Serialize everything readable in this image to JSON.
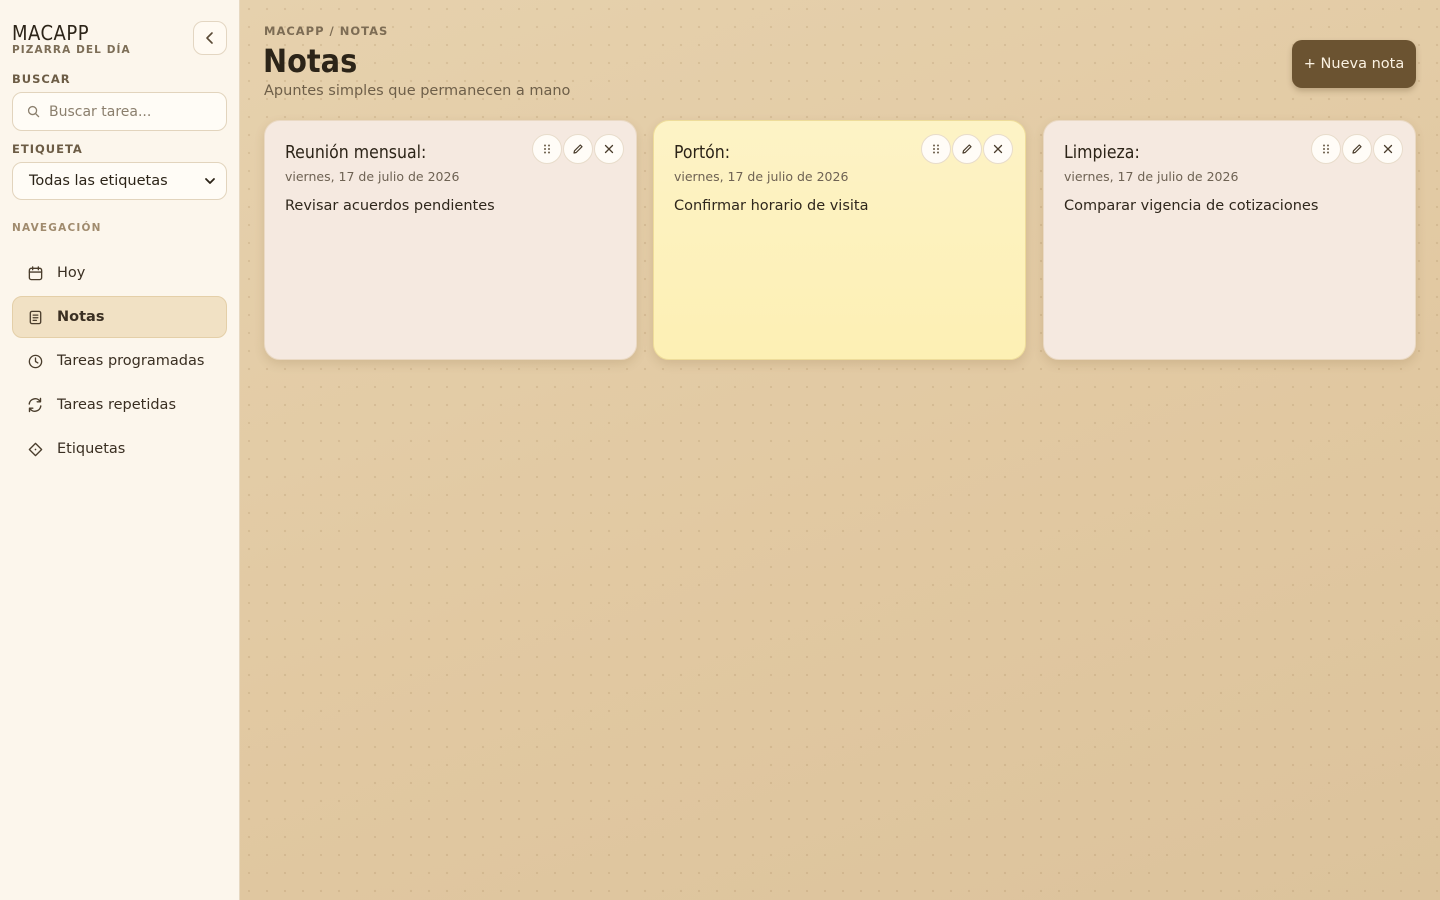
{
  "brand": {
    "title": "MACAPP",
    "subtitle": "PIZARRA DEL DÍA"
  },
  "sidebar": {
    "search_label": "BUSCAR",
    "search_placeholder": "Buscar tarea...",
    "tag_label": "ETIQUETA",
    "tag_selected": "Todas las etiquetas",
    "nav_label": "NAVEGACIÓN",
    "items": [
      {
        "label": "Hoy",
        "icon": "calendar-icon",
        "active": false
      },
      {
        "label": "Notas",
        "icon": "note-icon",
        "active": true
      },
      {
        "label": "Tareas programadas",
        "icon": "clock-icon",
        "active": false
      },
      {
        "label": "Tareas repetidas",
        "icon": "repeat-icon",
        "active": false
      },
      {
        "label": "Etiquetas",
        "icon": "tag-icon",
        "active": false
      }
    ]
  },
  "header": {
    "breadcrumb": "MACAPP / NOTAS",
    "title": "Notas",
    "subtitle": "Apuntes simples que permanecen a mano",
    "new_button": "+ Nueva nota"
  },
  "notes": [
    {
      "title": "Reunión mensual:",
      "date": "viernes, 17 de julio de 2026",
      "body": "Revisar acuerdos pendientes",
      "color": "#f5e9e0"
    },
    {
      "title": "Portón:",
      "date": "viernes, 17 de julio de 2026",
      "body": "Confirmar horario de visita",
      "color": "#fdf1bd"
    },
    {
      "title": "Limpieza:",
      "date": "viernes, 17 de julio de 2026",
      "body": "Comparar vigencia de cotizaciones",
      "color": "#f5e9e0"
    }
  ],
  "colors": {
    "accent": "#6b5331",
    "sidebar_bg": "#fcf6ec",
    "board_bg": "#e3cca6"
  }
}
